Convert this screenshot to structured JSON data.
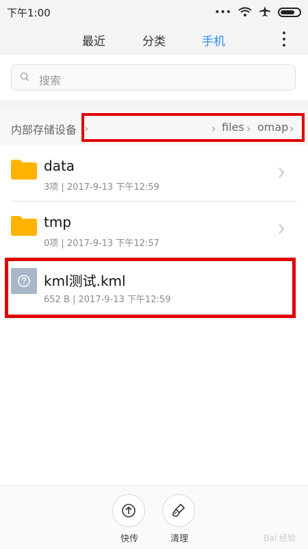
{
  "status_bar": {
    "time": "下午1:00"
  },
  "tabs": [
    {
      "label": "最近",
      "active": false
    },
    {
      "label": "分类",
      "active": false
    },
    {
      "label": "手机",
      "active": true
    }
  ],
  "search": {
    "placeholder": "搜索"
  },
  "breadcrumb": {
    "root": "内部存储设备",
    "items": [
      "files",
      "omap"
    ]
  },
  "files": [
    {
      "name": "data",
      "meta": "3项 | 2017-9-13 下午12:59",
      "type": "folder"
    },
    {
      "name": "tmp",
      "meta": "0项 | 2017-9-13 下午12:57",
      "type": "folder"
    },
    {
      "name": "kml测试.kml",
      "meta": "652 B | 2017-9-13 下午12:59",
      "type": "file"
    }
  ],
  "bottom_actions": [
    {
      "label": "快传",
      "icon": "upload-icon"
    },
    {
      "label": "清理",
      "icon": "brush-icon"
    }
  ],
  "colors": {
    "accent": "#2b8cff",
    "highlight": "#e00000",
    "folder": "#ffb300"
  },
  "watermark": "Bai 经验"
}
